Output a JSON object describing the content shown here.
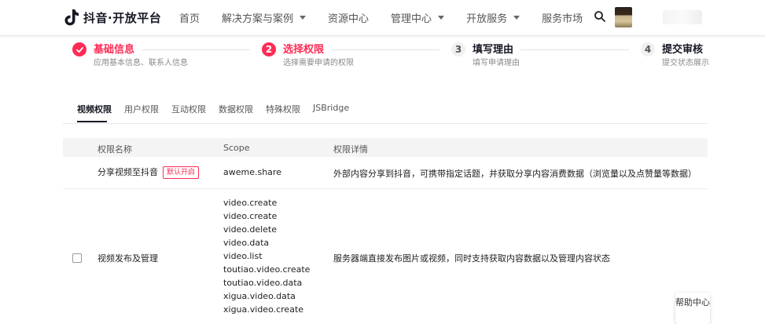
{
  "header": {
    "logo_text": "抖音·开放平台",
    "nav": [
      {
        "label": "首页",
        "dropdown": false
      },
      {
        "label": "解决方案与案例",
        "dropdown": true
      },
      {
        "label": "资源中心",
        "dropdown": false
      },
      {
        "label": "管理中心",
        "dropdown": true
      },
      {
        "label": "开放服务",
        "dropdown": true
      },
      {
        "label": "服务市场",
        "dropdown": false
      }
    ]
  },
  "steps": [
    {
      "number": "✓",
      "title": "基础信息",
      "desc": "应用基本信息、联系人信息",
      "state": "done"
    },
    {
      "number": "2",
      "title": "选择权限",
      "desc": "选择需要申请的权限",
      "state": "active"
    },
    {
      "number": "3",
      "title": "填写理由",
      "desc": "填写申请理由",
      "state": "pending"
    },
    {
      "number": "4",
      "title": "提交审核",
      "desc": "提交状态展示",
      "state": "pending"
    }
  ],
  "tabs": [
    "视频权限",
    "用户权限",
    "互动权限",
    "数据权限",
    "特殊权限",
    "JSBridge"
  ],
  "table": {
    "headers": [
      "权限名称",
      "Scope",
      "权限详情"
    ],
    "rows": [
      {
        "name": "分享视频至抖音",
        "tag": "默认开启",
        "scopes": [
          "aweme.share"
        ],
        "detail": "外部内容分享到抖音，可携带指定话题，并获取分享内容消费数据（浏览量以及点赞量等数据）"
      },
      {
        "name": "视频发布及管理",
        "scopes": [
          "video.create",
          "video.create",
          "video.delete",
          "video.data",
          "video.list",
          "toutiao.video.create",
          "toutiao.video.data",
          "xigua.video.data",
          "xigua.video.create"
        ],
        "detail": "服务器端直接发布图片或视频，同时支持获取内容数据以及管理内容状态"
      }
    ]
  },
  "help_label": "帮助中心",
  "colors": {
    "accent": "#fe2c55",
    "text": "#161823",
    "header_bg": "#f4f4f5"
  }
}
